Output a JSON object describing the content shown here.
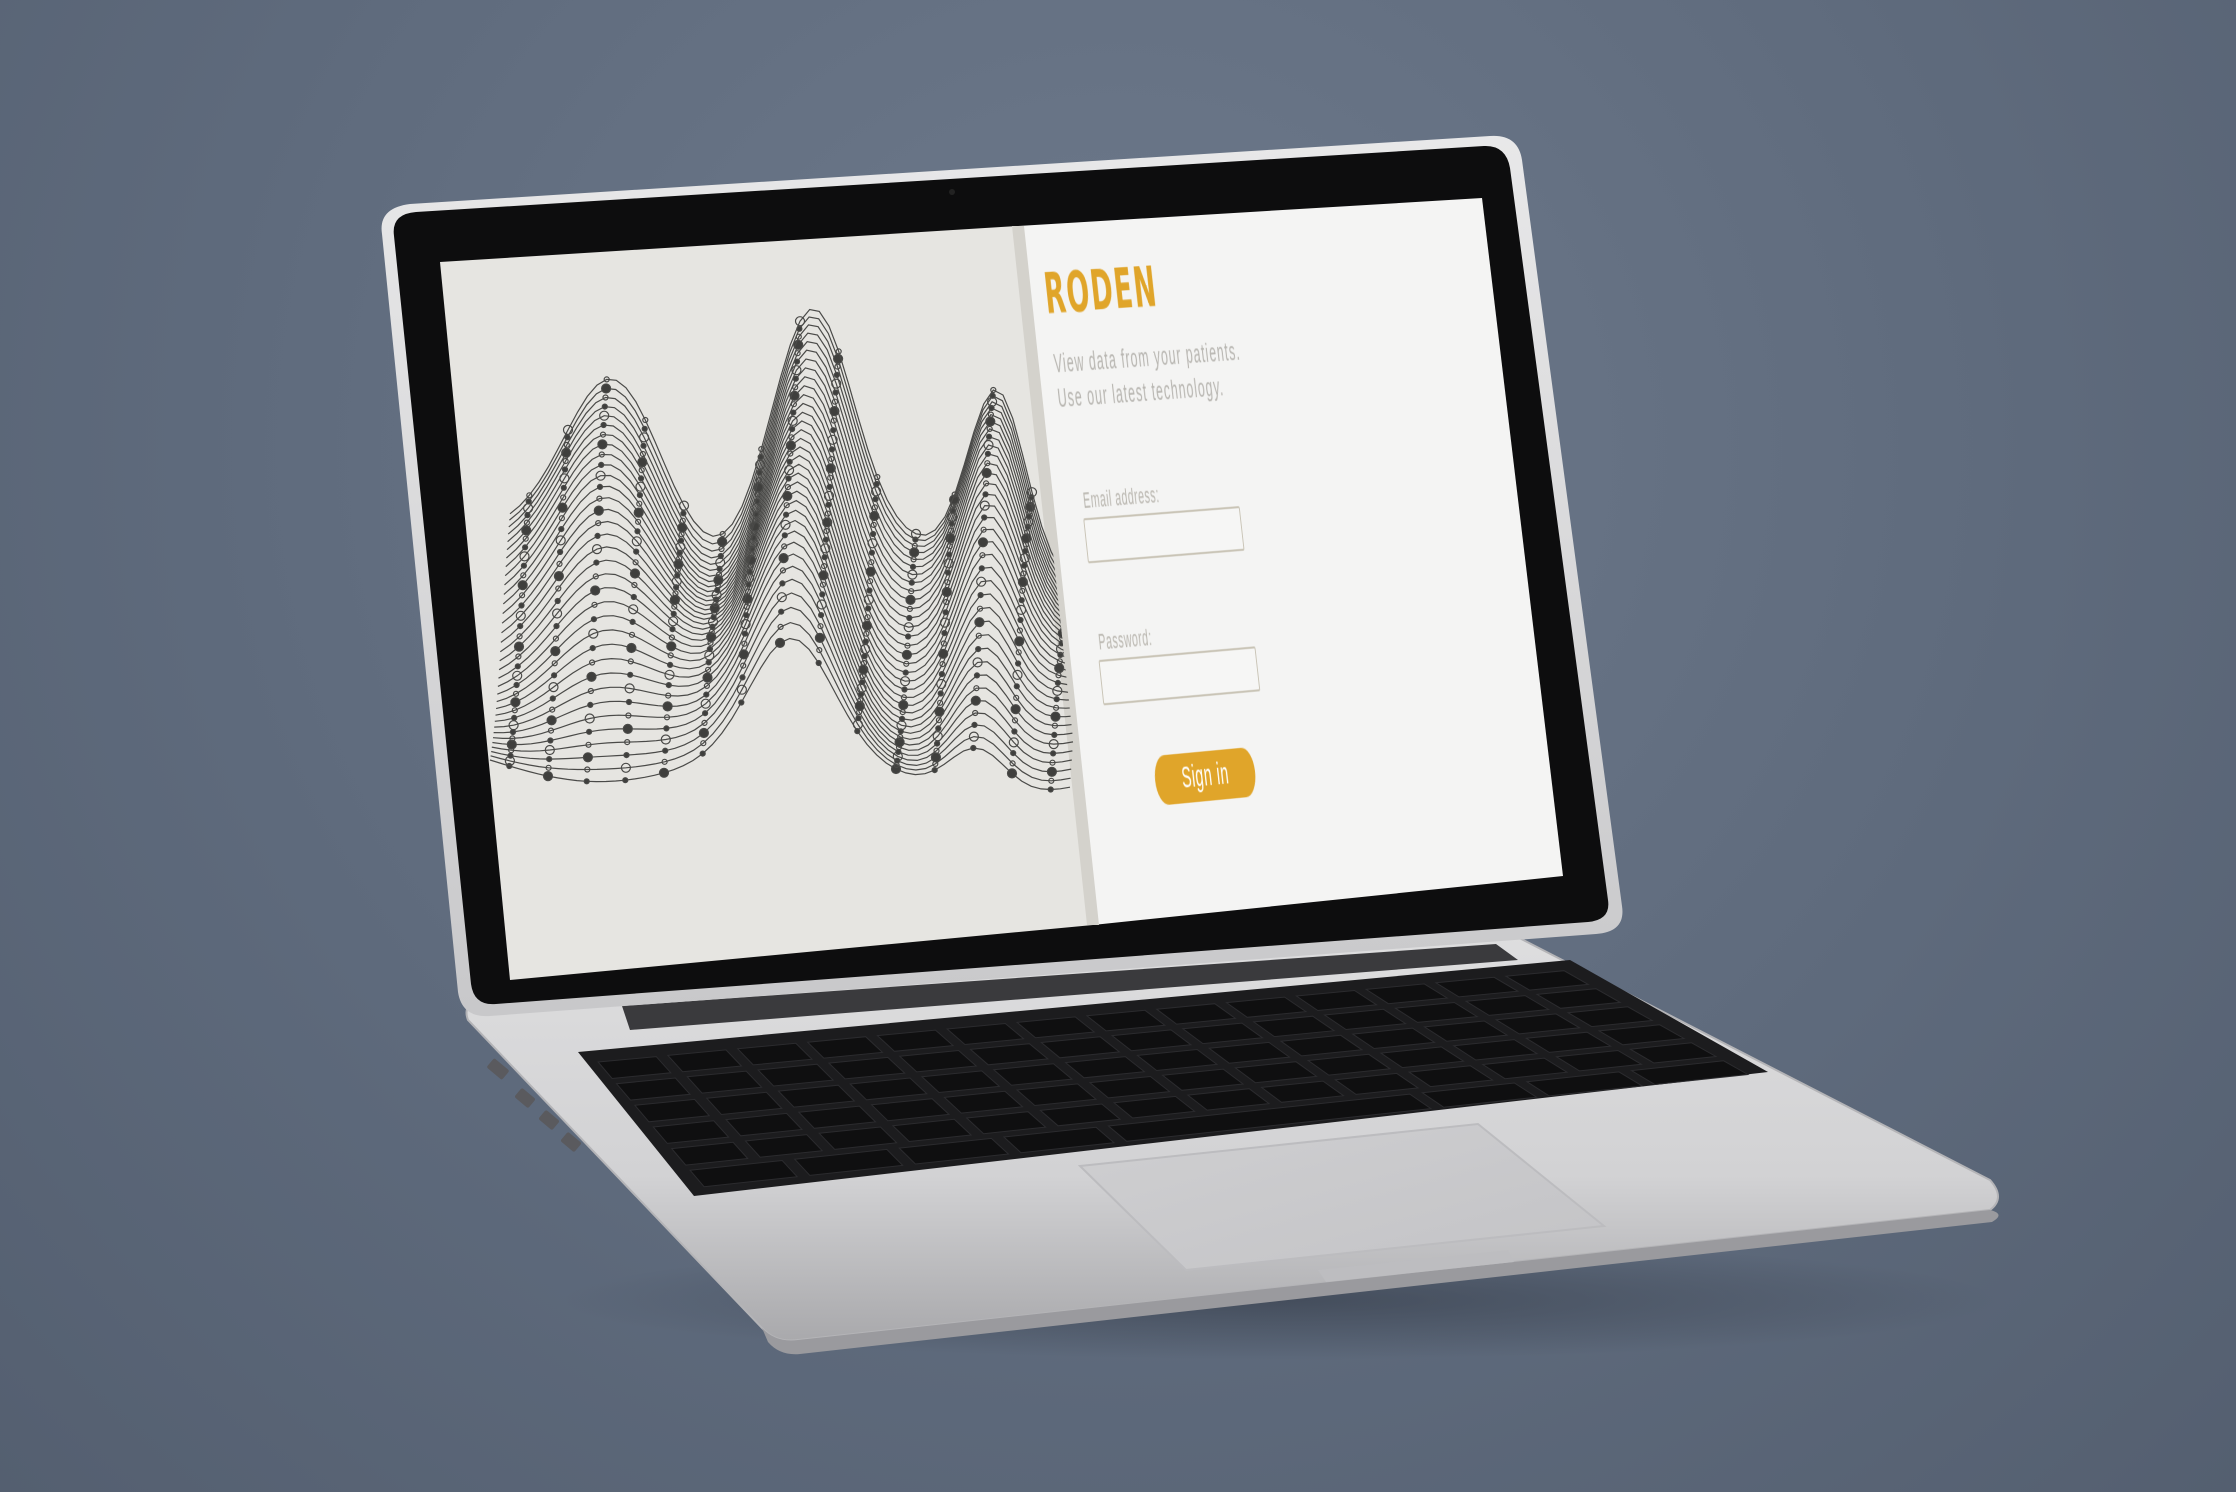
{
  "login": {
    "brand": "RODEN",
    "tagline_line1": "View data from your patients.",
    "tagline_line2": "Use our latest technology.",
    "email_label": "Email address:",
    "email_value": "",
    "password_label": "Password:",
    "password_value": "",
    "signin_label": "Sign in"
  },
  "colors": {
    "accent": "#e0a52a",
    "background": "#5f6b7d",
    "panel": "#f4f4f3",
    "artwork": "#e6e5e1",
    "bezel": "#0d0d0e",
    "chassis": "#d9d9da",
    "keys": "#161617"
  },
  "icons": {
    "artwork": "wave-particle-graphic",
    "device": "laptop"
  }
}
